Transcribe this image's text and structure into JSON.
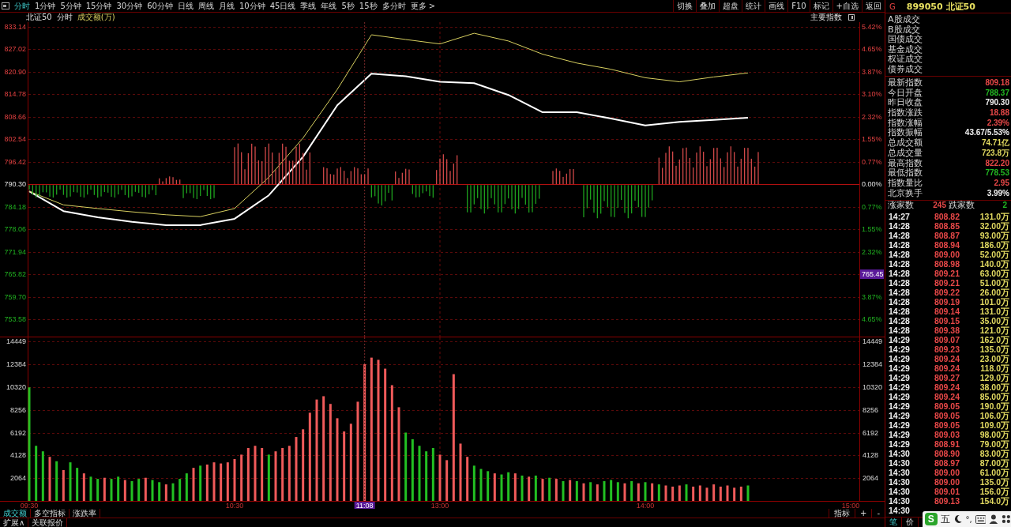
{
  "toolbar": {
    "periods": [
      {
        "label": "分时",
        "selected": true
      },
      {
        "label": "1分钟",
        "selected": false
      },
      {
        "label": "5分钟",
        "selected": false
      },
      {
        "label": "15分钟",
        "selected": false
      },
      {
        "label": "30分钟",
        "selected": false
      },
      {
        "label": "60分钟",
        "selected": false
      },
      {
        "label": "日线",
        "selected": false
      },
      {
        "label": "周线",
        "selected": false
      },
      {
        "label": "月线",
        "selected": false
      },
      {
        "label": "10分钟",
        "selected": false
      },
      {
        "label": "45日线",
        "selected": false
      },
      {
        "label": "季线",
        "selected": false
      },
      {
        "label": "年线",
        "selected": false
      },
      {
        "label": "5秒",
        "selected": false
      },
      {
        "label": "15秒",
        "selected": false
      },
      {
        "label": "多分时",
        "selected": false
      },
      {
        "label": "更多 >",
        "selected": false
      }
    ],
    "actions": [
      "切换",
      "叠加",
      "超盘",
      "统计",
      "画线",
      "F10",
      "标记",
      "+自选",
      "返回"
    ]
  },
  "chart_header": {
    "name": "北证50",
    "mode": "分时",
    "indicator": "成交额(万)",
    "index_button": "主要指数"
  },
  "price_chart": {
    "chart_data": {
      "type": "line",
      "categories": [
        null,
        null,
        null,
        null,
        null,
        null,
        null,
        null,
        null,
        null,
        null,
        null,
        null,
        null,
        null,
        null,
        null,
        null,
        null,
        null,
        null,
        null,
        null,
        null,
        null
      ],
      "series": [
        {
          "color": "#ffffff",
          "values": [
            788.4,
            783.0,
            781.3,
            780.1,
            779.2,
            779.2,
            780.9,
            787.3,
            797.8,
            811.8,
            820.4,
            819.7,
            818.2,
            817.8,
            814.6,
            809.9,
            809.9,
            808.2,
            806.3,
            807.3,
            807.8,
            808.4,
            null,
            null,
            null
          ]
        },
        {
          "color": "#d8d060",
          "values": [
            788.4,
            784.7,
            783.7,
            782.8,
            782.0,
            781.5,
            783.7,
            792.2,
            802.9,
            816.1,
            831.0,
            829.7,
            828.5,
            831.4,
            829.3,
            825.7,
            823.3,
            821.6,
            819.3,
            818.2,
            819.5,
            820.6,
            null,
            null,
            null
          ]
        }
      ],
      "ylim": [
        753.58,
        833.14
      ],
      "grid": true,
      "ref_lines": [
        {
          "axis": "y",
          "value": 790.3
        }
      ],
      "yticks": [
        {
          "value": 833.14,
          "label": "833.14"
        },
        {
          "value": 827.02,
          "label": "827.02"
        },
        {
          "value": 820.9,
          "label": "820.90"
        },
        {
          "value": 814.78,
          "label": "814.78"
        },
        {
          "value": 808.66,
          "label": "808.66"
        },
        {
          "value": 802.54,
          "label": "802.54"
        },
        {
          "value": 796.42,
          "label": "796.42"
        },
        {
          "value": 790.3,
          "label": "790.30"
        },
        {
          "value": 784.18,
          "label": "784.18"
        },
        {
          "value": 778.06,
          "label": "778.06"
        },
        {
          "value": 771.94,
          "label": "771.94"
        },
        {
          "value": 765.82,
          "label": "765.82"
        },
        {
          "value": 759.7,
          "label": "759.70"
        },
        {
          "value": 753.58,
          "label": "753.58"
        }
      ]
    },
    "right_axis_labels": [
      {
        "label": "5.42%",
        "cursor": false
      },
      {
        "label": "4.65%",
        "cursor": false
      },
      {
        "label": "3.87%",
        "cursor": false
      },
      {
        "label": "3.10%",
        "cursor": false
      },
      {
        "label": "2.32%",
        "cursor": false
      },
      {
        "label": "1.55%",
        "cursor": false
      },
      {
        "label": "0.77%",
        "cursor": false
      },
      {
        "label": "0.00%",
        "cursor": false
      },
      {
        "label": "0.77%",
        "cursor": false
      },
      {
        "label": "1.55%",
        "cursor": false
      },
      {
        "label": "2.32%",
        "cursor": false
      },
      {
        "label": "765.45",
        "cursor": true
      },
      {
        "label": "3.87%",
        "cursor": false
      },
      {
        "label": "4.65%",
        "cursor": false
      }
    ]
  },
  "volume_chart": {
    "chart_data": {
      "type": "bar",
      "categories": [
        "09:30",
        null,
        null,
        null,
        null,
        null,
        null,
        null,
        null,
        null,
        null,
        null,
        null,
        null,
        null,
        null,
        null,
        null,
        null,
        null,
        null,
        null,
        null,
        null,
        null,
        null,
        null,
        null,
        null,
        null,
        "10:30",
        null,
        null,
        null,
        null,
        null,
        null,
        null,
        null,
        null,
        null,
        null,
        null,
        null,
        null,
        null,
        null,
        null,
        null,
        "11:08",
        null,
        null,
        null,
        null,
        null,
        null,
        null,
        null,
        null,
        null,
        "13:00",
        null,
        null,
        null,
        null,
        null,
        null,
        null,
        null,
        null,
        null,
        null,
        null,
        null,
        null,
        null,
        null,
        null,
        null,
        null,
        null,
        null,
        null,
        null,
        null,
        null,
        null,
        null,
        null,
        null,
        "14:00",
        null,
        null,
        null,
        null,
        null,
        null,
        null,
        null,
        null,
        null,
        null,
        null,
        null,
        null,
        null,
        null,
        null,
        null,
        null,
        null,
        null,
        null,
        null,
        null,
        null,
        null,
        null,
        null,
        null,
        "15:00"
      ],
      "series": [
        {
          "color": "#f05a5a",
          "values": [
            null,
            null,
            null,
            4000,
            null,
            2800,
            null,
            null,
            2500,
            null,
            null,
            2100,
            null,
            null,
            1900,
            null,
            null,
            2100,
            null,
            null,
            1500,
            null,
            null,
            null,
            3000,
            null,
            3300,
            3500,
            3400,
            3500,
            3800,
            4200,
            4800,
            5000,
            4800,
            null,
            4500,
            4800,
            5000,
            5800,
            6500,
            8000,
            9200,
            9500,
            8800,
            7500,
            6300,
            7000,
            9000,
            12400,
            13000,
            12800,
            12000,
            10500,
            8500,
            null,
            null,
            null,
            null,
            null,
            4200,
            3700,
            11500,
            5200,
            4000,
            null,
            null,
            null,
            2500,
            null,
            null,
            2500,
            null,
            2200,
            null,
            2000,
            null,
            2000,
            null,
            1900,
            null,
            1600,
            null,
            1500,
            null,
            null,
            null,
            1600,
            null,
            1600,
            null,
            1600,
            null,
            1400,
            1300,
            1400,
            null,
            1300,
            1400,
            1200,
            1500,
            1300,
            1400,
            1200,
            1300,
            null,
            null,
            null,
            null,
            null,
            null,
            null,
            null,
            null,
            null,
            null,
            null,
            null,
            null,
            null,
            null
          ]
        },
        {
          "color": "#22c022",
          "values": [
            10300,
            5000,
            4500,
            null,
            3600,
            null,
            3500,
            3000,
            null,
            2200,
            2000,
            null,
            2000,
            2200,
            null,
            1800,
            2000,
            null,
            1900,
            1700,
            null,
            1600,
            2000,
            2500,
            null,
            3200,
            null,
            null,
            null,
            null,
            null,
            null,
            null,
            null,
            null,
            4200,
            null,
            null,
            null,
            null,
            null,
            null,
            null,
            null,
            null,
            null,
            null,
            null,
            null,
            null,
            null,
            null,
            null,
            null,
            null,
            6200,
            5600,
            5000,
            4500,
            4800,
            null,
            null,
            null,
            null,
            null,
            3200,
            2900,
            2700,
            null,
            2400,
            2600,
            null,
            2300,
            null,
            2300,
            null,
            2100,
            null,
            1800,
            null,
            1800,
            null,
            1700,
            null,
            1800,
            1900,
            1700,
            null,
            1800,
            null,
            1700,
            null,
            1500,
            null,
            null,
            null,
            1500,
            null,
            null,
            null,
            null,
            null,
            null,
            null,
            null,
            1400,
            null,
            null,
            null,
            null,
            null,
            null,
            null,
            null,
            null,
            null,
            null,
            null,
            null,
            null,
            null
          ]
        }
      ],
      "ylim": [
        0,
        14449
      ],
      "grid": true,
      "yticks": [
        14449,
        12384,
        10320,
        8256,
        6192,
        4128,
        2064
      ],
      "annotations": [
        {
          "x": "11:08"
        }
      ]
    },
    "right_axis_labels": [
      "14449",
      "12384",
      "10320",
      "8256",
      "6192",
      "4128",
      "2064"
    ]
  },
  "bottom_bar": {
    "indicator_tabs": [
      {
        "label": "成交额",
        "selected": true
      },
      {
        "label": "多空指标",
        "selected": false
      },
      {
        "label": "涨跌率",
        "selected": false
      }
    ],
    "tools": [
      "指标",
      "+",
      "-"
    ],
    "links": [
      "扩展∧",
      "关联报价"
    ]
  },
  "quote_panel": {
    "flag": "G",
    "title": "899050 北证50",
    "volume_labels": [
      "A股成交",
      "B股成交",
      "国债成交",
      "基金成交",
      "权证成交",
      "债券成交"
    ],
    "stats": [
      {
        "label": "最新指数",
        "value": "809.18",
        "color": "#e84848"
      },
      {
        "label": "今日开盘",
        "value": "788.37",
        "color": "#22b822"
      },
      {
        "label": "昨日收盘",
        "value": "790.30",
        "color": "#f0f0f0"
      },
      {
        "label": "指数涨跌",
        "value": "18.88",
        "color": "#e84848"
      },
      {
        "label": "指数涨幅",
        "value": "2.39%",
        "color": "#e84848"
      },
      {
        "label": "指数振幅",
        "value": "43.67/5.53%",
        "color": "#f0f0f0"
      },
      {
        "label": "总成交额",
        "value": "74.71亿",
        "color": "#e0d860"
      },
      {
        "label": "总成交量",
        "value": "723.8万",
        "color": "#e0d860"
      },
      {
        "label": "最高指数",
        "value": "822.20",
        "color": "#e84848"
      },
      {
        "label": "最低指数",
        "value": "778.53",
        "color": "#22b822"
      },
      {
        "label": "指数量比",
        "value": "2.95",
        "color": "#e84848"
      },
      {
        "label": "北京换手",
        "value": "3.99%",
        "color": "#f0f0f0"
      }
    ],
    "breadth": {
      "up_label": "涨家数",
      "up_count": "245",
      "down_label": "跌家数",
      "down_count": "2"
    },
    "ticks": [
      {
        "time": "14:27",
        "price": "808.82",
        "volume": "131.0万"
      },
      {
        "time": "14:28",
        "price": "808.85",
        "volume": "32.00万"
      },
      {
        "time": "14:28",
        "price": "808.87",
        "volume": "93.00万"
      },
      {
        "time": "14:28",
        "price": "808.94",
        "volume": "186.0万"
      },
      {
        "time": "14:28",
        "price": "809.00",
        "volume": "52.00万"
      },
      {
        "time": "14:28",
        "price": "808.98",
        "volume": "140.0万"
      },
      {
        "time": "14:28",
        "price": "809.21",
        "volume": "63.00万"
      },
      {
        "time": "14:28",
        "price": "809.21",
        "volume": "51.00万"
      },
      {
        "time": "14:28",
        "price": "809.22",
        "volume": "26.00万"
      },
      {
        "time": "14:28",
        "price": "809.19",
        "volume": "101.0万"
      },
      {
        "time": "14:28",
        "price": "809.14",
        "volume": "131.0万"
      },
      {
        "time": "14:28",
        "price": "809.15",
        "volume": "35.00万"
      },
      {
        "time": "14:28",
        "price": "809.38",
        "volume": "121.0万"
      },
      {
        "time": "14:29",
        "price": "809.07",
        "volume": "162.0万"
      },
      {
        "time": "14:29",
        "price": "809.23",
        "volume": "135.0万"
      },
      {
        "time": "14:29",
        "price": "809.24",
        "volume": "23.00万"
      },
      {
        "time": "14:29",
        "price": "809.24",
        "volume": "118.0万"
      },
      {
        "time": "14:29",
        "price": "809.27",
        "volume": "129.0万"
      },
      {
        "time": "14:29",
        "price": "809.24",
        "volume": "38.00万"
      },
      {
        "time": "14:29",
        "price": "809.24",
        "volume": "85.00万"
      },
      {
        "time": "14:29",
        "price": "809.05",
        "volume": "190.0万"
      },
      {
        "time": "14:29",
        "price": "809.05",
        "volume": "106.0万"
      },
      {
        "time": "14:29",
        "price": "809.05",
        "volume": "109.0万"
      },
      {
        "time": "14:29",
        "price": "809.03",
        "volume": "98.00万"
      },
      {
        "time": "14:29",
        "price": "808.91",
        "volume": "79.00万"
      },
      {
        "time": "14:30",
        "price": "808.90",
        "volume": "83.00万"
      },
      {
        "time": "14:30",
        "price": "808.97",
        "volume": "87.00万"
      },
      {
        "time": "14:30",
        "price": "809.00",
        "volume": "61.00万"
      },
      {
        "time": "14:30",
        "price": "809.00",
        "volume": "135.0万"
      },
      {
        "time": "14:30",
        "price": "809.01",
        "volume": "156.0万"
      },
      {
        "time": "14:30",
        "price": "809.13",
        "volume": "154.0万"
      },
      {
        "time": "14:30"
      }
    ],
    "tabs": [
      {
        "label": "笔",
        "selected": true
      },
      {
        "label": "价",
        "selected": false
      }
    ]
  },
  "ime_toolbar": {
    "logo": "S",
    "mode": "五",
    "punctuation": "°,"
  }
}
